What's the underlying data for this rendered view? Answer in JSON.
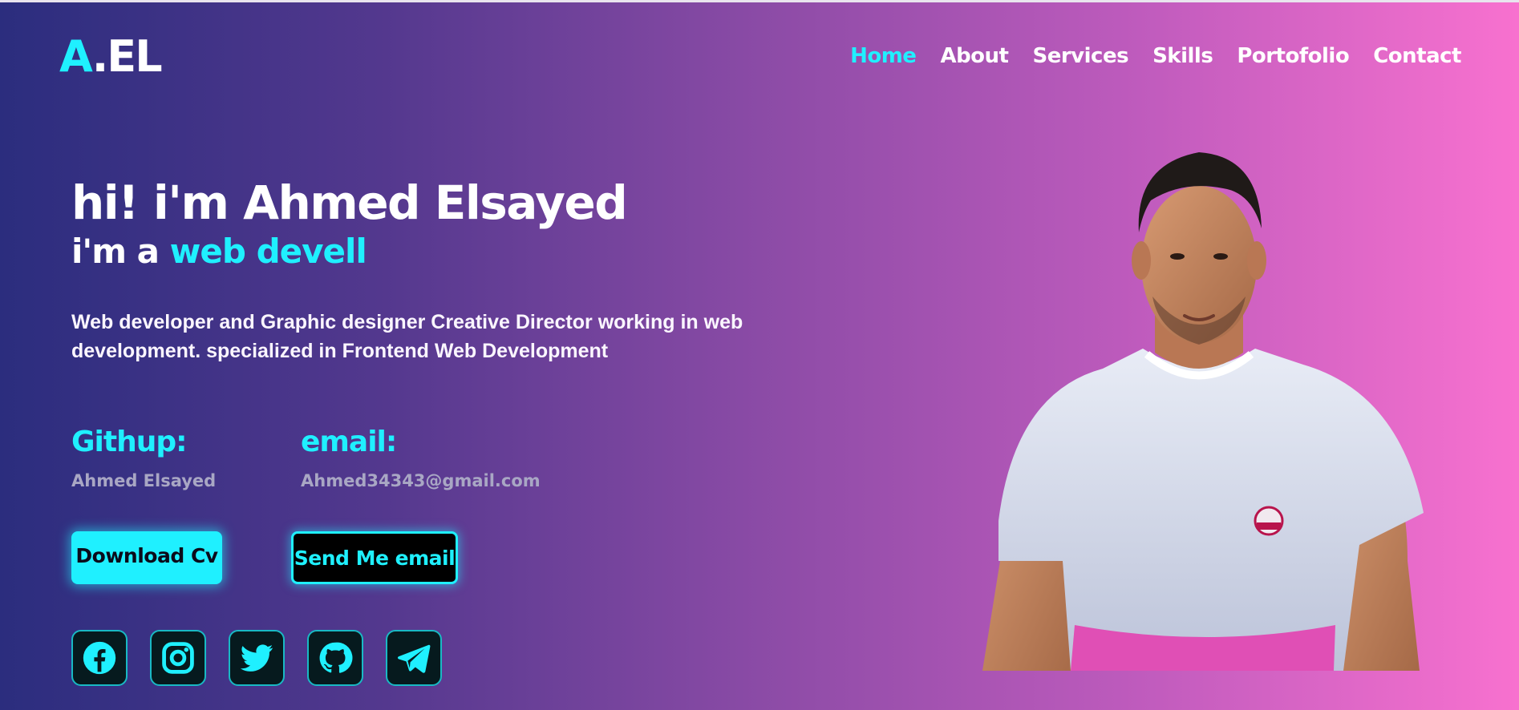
{
  "logo": {
    "accent": "A",
    "rest": ".EL"
  },
  "nav": {
    "items": [
      {
        "label": "Home",
        "active": true
      },
      {
        "label": "About",
        "active": false
      },
      {
        "label": "Services",
        "active": false
      },
      {
        "label": "Skills",
        "active": false
      },
      {
        "label": "Portofolio",
        "active": false
      },
      {
        "label": "Contact",
        "active": false
      }
    ]
  },
  "hero": {
    "greeting": "hi! i'm Ahmed Elsayed",
    "role_prefix": "i'm a",
    "role_typed": "web devell",
    "description": "Web developer and Graphic designer Creative Director working in web development. specialized in Frontend Web Development"
  },
  "info": {
    "github_label": "Githup:",
    "github_value": "Ahmed Elsayed",
    "email_label": "email:",
    "email_value": "Ahmed34343@gmail.com"
  },
  "buttons": {
    "download": "Download Cv",
    "email": "Send Me email"
  },
  "socials": [
    {
      "icon": "facebook-icon"
    },
    {
      "icon": "instagram-icon"
    },
    {
      "icon": "twitter-icon"
    },
    {
      "icon": "github-icon"
    },
    {
      "icon": "telegram-icon"
    }
  ],
  "colors": {
    "accent": "#1ff0ff",
    "gradient_start": "#2b2d7e",
    "gradient_end": "#f871cf",
    "value_text": "#a9a7c4"
  }
}
